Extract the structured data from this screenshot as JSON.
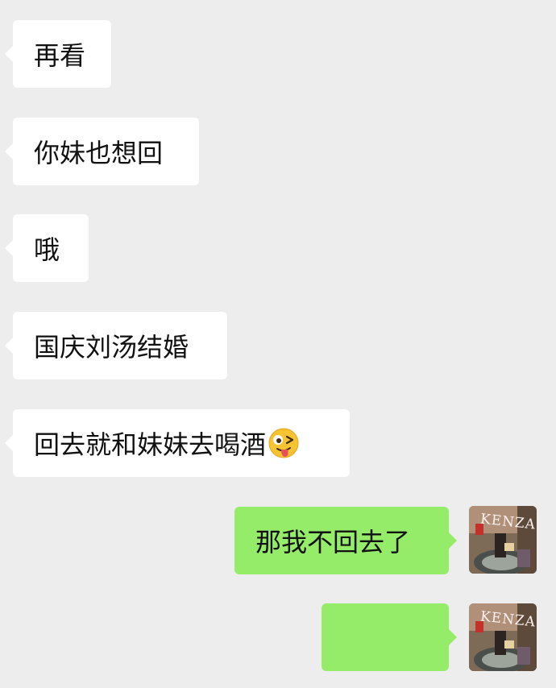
{
  "chat": {
    "messages": [
      {
        "sender": "other",
        "text": "再看"
      },
      {
        "sender": "other",
        "text": "你妹也想回"
      },
      {
        "sender": "other",
        "text": "哦"
      },
      {
        "sender": "other",
        "text": "国庆刘汤结婚"
      },
      {
        "sender": "other",
        "text": "回去就和妹妹去喝酒",
        "emoji": "winking-face-with-tongue"
      },
      {
        "sender": "me",
        "text": "那我不回去了"
      },
      {
        "sender": "me",
        "text": "",
        "note": "obscured"
      }
    ],
    "avatar_text": "KENZA"
  },
  "colors": {
    "background": "#ededed",
    "incoming_bubble": "#ffffff",
    "outgoing_bubble": "#95ec69",
    "text": "#111111"
  }
}
